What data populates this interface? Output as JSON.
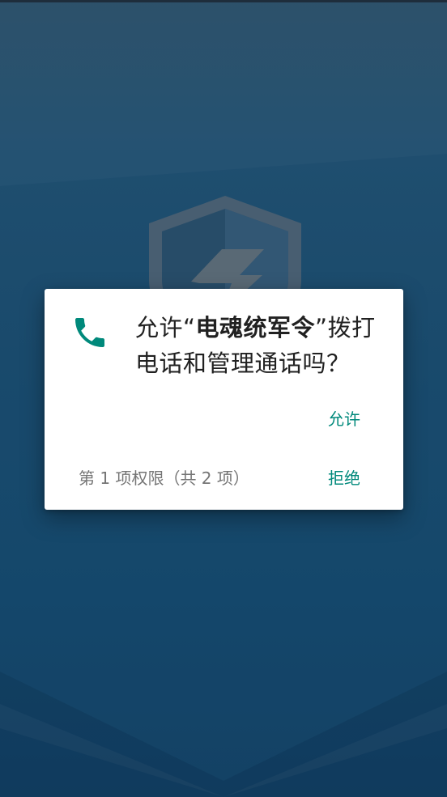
{
  "colors": {
    "accent": "#00897b",
    "title_text": "#212121",
    "secondary_text": "#757575",
    "dialog_bg": "#ffffff",
    "background": "#1d5579"
  },
  "dialog": {
    "icon": "phone-icon",
    "title_prefix": "允许“",
    "app_name": "电魂统军令",
    "title_suffix": "”拨打电话和管理通话吗？",
    "allow_label": "允许",
    "deny_label": "拒绝",
    "counter": "第 1 项权限（共 2 项）"
  },
  "background": {
    "logo": "shield-logo-icon"
  }
}
